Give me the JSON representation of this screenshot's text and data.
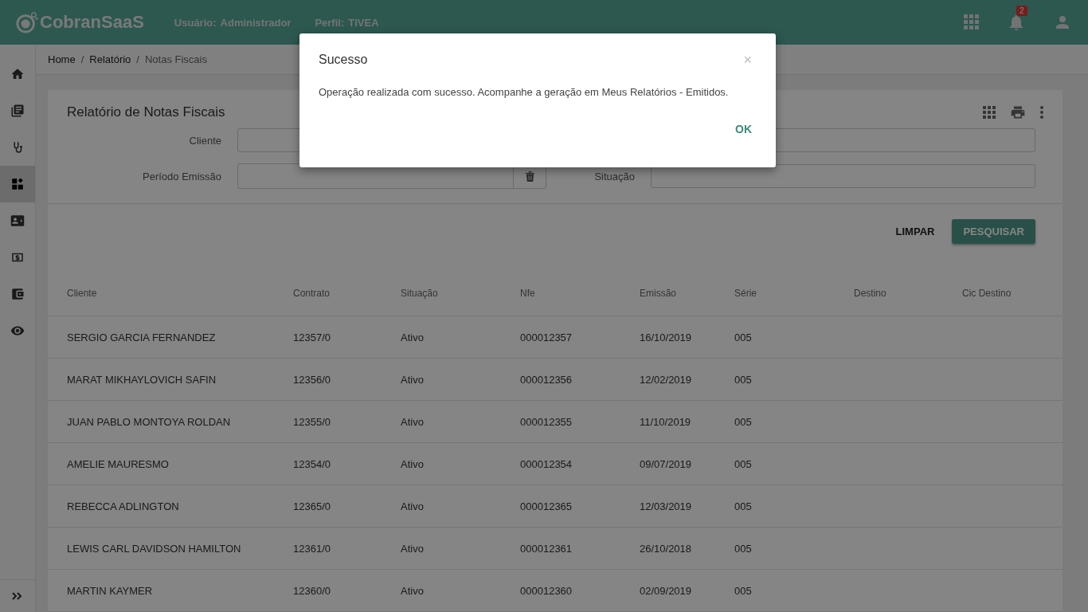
{
  "header": {
    "brand": "CobranSaaS",
    "user_label": "Usuário:",
    "user": "Administrador",
    "profile_label": "Perfil:",
    "profile": "TIVEA",
    "notifications": "2"
  },
  "sidebar": {
    "items": [
      {
        "selected": false
      },
      {
        "selected": false
      },
      {
        "selected": false
      },
      {
        "selected": true
      },
      {
        "selected": false
      },
      {
        "selected": false
      },
      {
        "selected": false
      },
      {
        "selected": false
      }
    ]
  },
  "breadcrumb": {
    "separator": "/",
    "items": [
      "Home",
      "Relatório",
      "Notas Fiscais"
    ]
  },
  "card": {
    "title": "Relatório de Notas Fiscais",
    "filters": [
      {
        "label": "Cliente"
      },
      {
        "label": "Período Emissão",
        "kind": "date"
      },
      {
        "label": "Situação"
      }
    ],
    "buttons": {
      "clear": "LIMPAR",
      "search": "PESQUISAR"
    }
  },
  "table": {
    "columns": [
      "Cliente",
      "Contrato",
      "Situação",
      "Nfe",
      "Emissão",
      "Série",
      "Destino",
      "Cic Destino"
    ],
    "rows": [
      [
        "SERGIO GARCIA FERNANDEZ",
        "12357/0",
        "Ativo",
        "000012357",
        "16/10/2019",
        "005"
      ],
      [
        "MARAT MIKHAYLOVICH SAFIN",
        "12356/0",
        "Ativo",
        "000012356",
        "12/02/2019",
        "005"
      ],
      [
        "JUAN PABLO MONTOYA ROLDAN",
        "12355/0",
        "Ativo",
        "000012355",
        "11/10/2019",
        "005"
      ],
      [
        "AMELIE MAURESMO",
        "12354/0",
        "Ativo",
        "000012354",
        "09/07/2019",
        "005"
      ],
      [
        "REBECCA ADLINGTON",
        "12365/0",
        "Ativo",
        "000012365",
        "12/03/2019",
        "005"
      ],
      [
        "LEWIS CARL DAVIDSON HAMILTON",
        "12361/0",
        "Ativo",
        "000012361",
        "26/10/2018",
        "005"
      ],
      [
        "MARTIN KAYMER",
        "12360/0",
        "Ativo",
        "000012360",
        "02/09/2019",
        "005"
      ]
    ]
  },
  "dialog": {
    "title": "Sucesso",
    "close": "×",
    "message": "Operação realizada com sucesso. Acompanhe a geração em Meus Relatórios - Emitidos.",
    "ok": "OK"
  }
}
